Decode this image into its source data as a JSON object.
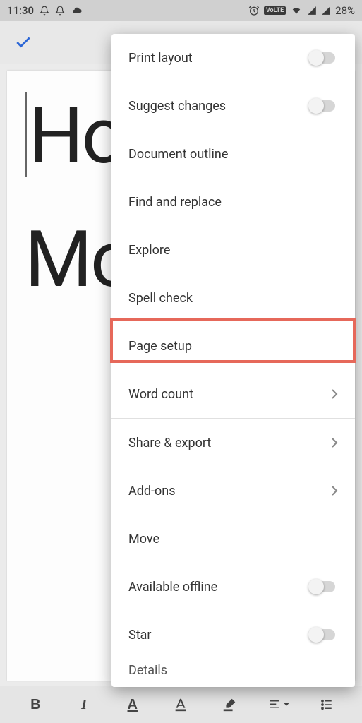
{
  "status": {
    "time": "11:30",
    "battery": "28%",
    "volte": "VoLTE"
  },
  "doc": {
    "line1": "Ho",
    "line2": "Mo"
  },
  "menu": {
    "print_layout": "Print layout",
    "suggest_changes": "Suggest changes",
    "document_outline": "Document outline",
    "find_replace": "Find and replace",
    "explore": "Explore",
    "spell_check": "Spell check",
    "page_setup": "Page setup",
    "word_count": "Word count",
    "share_export": "Share & export",
    "add_ons": "Add-ons",
    "move": "Move",
    "available_offline": "Available offline",
    "star": "Star",
    "details_cut": "Details"
  },
  "toolbar": {
    "bold": "B",
    "italic": "I",
    "underline": "A"
  }
}
